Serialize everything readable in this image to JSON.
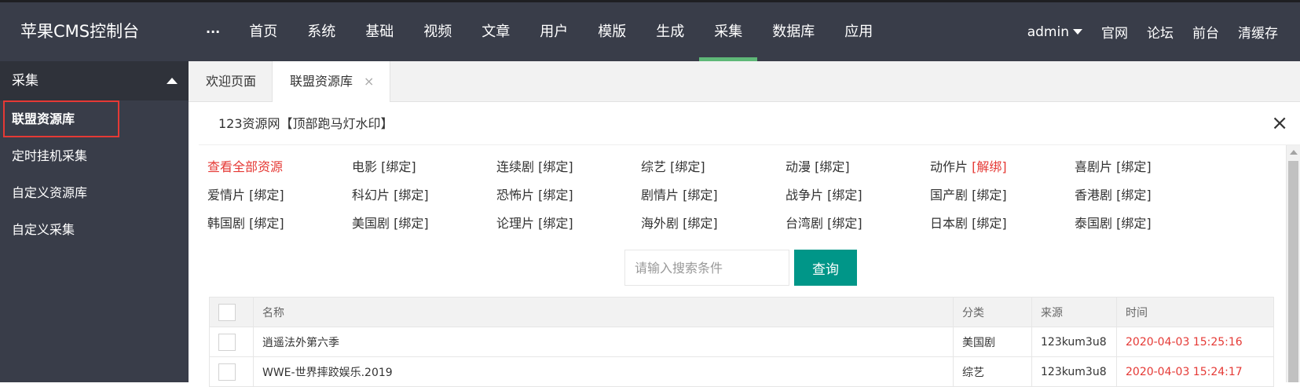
{
  "brand": "苹果CMS控制台",
  "nav": {
    "more": "···",
    "items": [
      "首页",
      "系统",
      "基础",
      "视频",
      "文章",
      "用户",
      "模版",
      "生成",
      "采集",
      "数据库",
      "应用"
    ],
    "active": "采集"
  },
  "nav_right": {
    "user": "admin",
    "links": [
      "官网",
      "论坛",
      "前台",
      "清缓存"
    ]
  },
  "sidebar": {
    "header": "采集",
    "items": [
      "联盟资源库",
      "定时挂机采集",
      "自定义资源库",
      "自定义采集"
    ],
    "active": "联盟资源库"
  },
  "tabs": [
    {
      "label": "欢迎页面",
      "active": false
    },
    {
      "label": "联盟资源库",
      "active": true,
      "close": "×"
    }
  ],
  "panel": {
    "title": "123资源网【顶部跑马灯水印】",
    "close": "×"
  },
  "categories": {
    "view_all": "查看全部资源",
    "rows": [
      [
        {
          "name": "电影",
          "bind": "[绑定]"
        },
        {
          "name": "连续剧",
          "bind": "[绑定]"
        },
        {
          "name": "综艺",
          "bind": "[绑定]"
        },
        {
          "name": "动漫",
          "bind": "[绑定]"
        },
        {
          "name": "动作片",
          "bind": "[解绑]"
        },
        {
          "name": "喜剧片",
          "bind": "[绑定]"
        }
      ],
      [
        {
          "name": "爱情片",
          "bind": "[绑定]"
        },
        {
          "name": "科幻片",
          "bind": "[绑定]"
        },
        {
          "name": "恐怖片",
          "bind": "[绑定]"
        },
        {
          "name": "剧情片",
          "bind": "[绑定]"
        },
        {
          "name": "战争片",
          "bind": "[绑定]"
        },
        {
          "name": "国产剧",
          "bind": "[绑定]"
        },
        {
          "name": "香港剧",
          "bind": "[绑定]"
        }
      ],
      [
        {
          "name": "韩国剧",
          "bind": "[绑定]"
        },
        {
          "name": "美国剧",
          "bind": "[绑定]"
        },
        {
          "name": "论理片",
          "bind": "[绑定]"
        },
        {
          "name": "海外剧",
          "bind": "[绑定]"
        },
        {
          "name": "台湾剧",
          "bind": "[绑定]"
        },
        {
          "name": "日本剧",
          "bind": "[绑定]"
        },
        {
          "name": "泰国剧",
          "bind": "[绑定]"
        }
      ]
    ]
  },
  "search": {
    "placeholder": "请输入搜索条件",
    "button": "查询"
  },
  "table": {
    "headers": [
      "名称",
      "分类",
      "来源",
      "时间"
    ],
    "rows": [
      {
        "name": "逍遥法外第六季",
        "category": "美国剧",
        "source": "123kum3u8",
        "time": "2020-04-03 15:25:16"
      },
      {
        "name": "WWE-世界摔跤娱乐.2019",
        "category": "综艺",
        "source": "123kum3u8",
        "time": "2020-04-03 15:24:17"
      }
    ]
  },
  "colors": {
    "topbar": "#393d49",
    "accent_green": "#5fb878",
    "button": "#009688",
    "red": "#e53935"
  }
}
